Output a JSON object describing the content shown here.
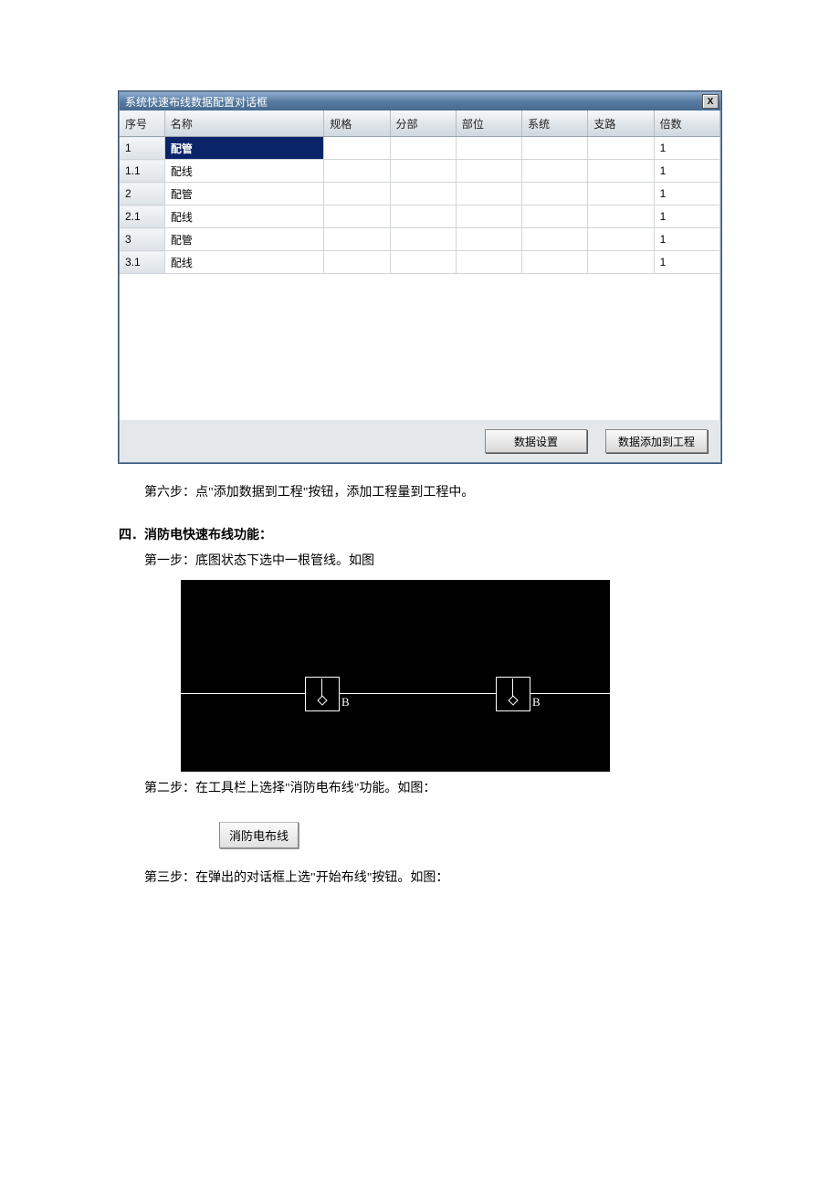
{
  "dialog": {
    "title": "系统快速布线数据配置对话框",
    "close_icon": "X",
    "headers": [
      "序号",
      "名称",
      "规格",
      "分部",
      "部位",
      "系统",
      "支路",
      "倍数"
    ],
    "rows": [
      {
        "idx": "1",
        "name": "配管",
        "spec": "",
        "div": "",
        "pos": "",
        "sys": "",
        "branch": "",
        "mult": "1",
        "selected": true
      },
      {
        "idx": "1.1",
        "name": "配线",
        "spec": "",
        "div": "",
        "pos": "",
        "sys": "",
        "branch": "",
        "mult": "1",
        "selected": false
      },
      {
        "idx": "2",
        "name": "配管",
        "spec": "",
        "div": "",
        "pos": "",
        "sys": "",
        "branch": "",
        "mult": "1",
        "selected": false
      },
      {
        "idx": "2.1",
        "name": "配线",
        "spec": "",
        "div": "",
        "pos": "",
        "sys": "",
        "branch": "",
        "mult": "1",
        "selected": false
      },
      {
        "idx": "3",
        "name": "配管",
        "spec": "",
        "div": "",
        "pos": "",
        "sys": "",
        "branch": "",
        "mult": "1",
        "selected": false
      },
      {
        "idx": "3.1",
        "name": "配线",
        "spec": "",
        "div": "",
        "pos": "",
        "sys": "",
        "branch": "",
        "mult": "1",
        "selected": false
      }
    ],
    "btn_settings": "数据设置",
    "btn_add": "数据添加到工程"
  },
  "body": {
    "step6": "第六步：点\"添加数据到工程\"按钮，添加工程量到工程中。",
    "section4": "四．消防电快速布线功能：",
    "step1": "第一步：底图状态下选中一根管线。如图",
    "cad_label": "B",
    "step2": "第二步：在工具栏上选择\"消防电布线\"功能。如图：",
    "toolbar_btn": "消防电布线",
    "step3": "第三步：在弹出的对话框上选\"开始布线\"按钮。如图："
  }
}
